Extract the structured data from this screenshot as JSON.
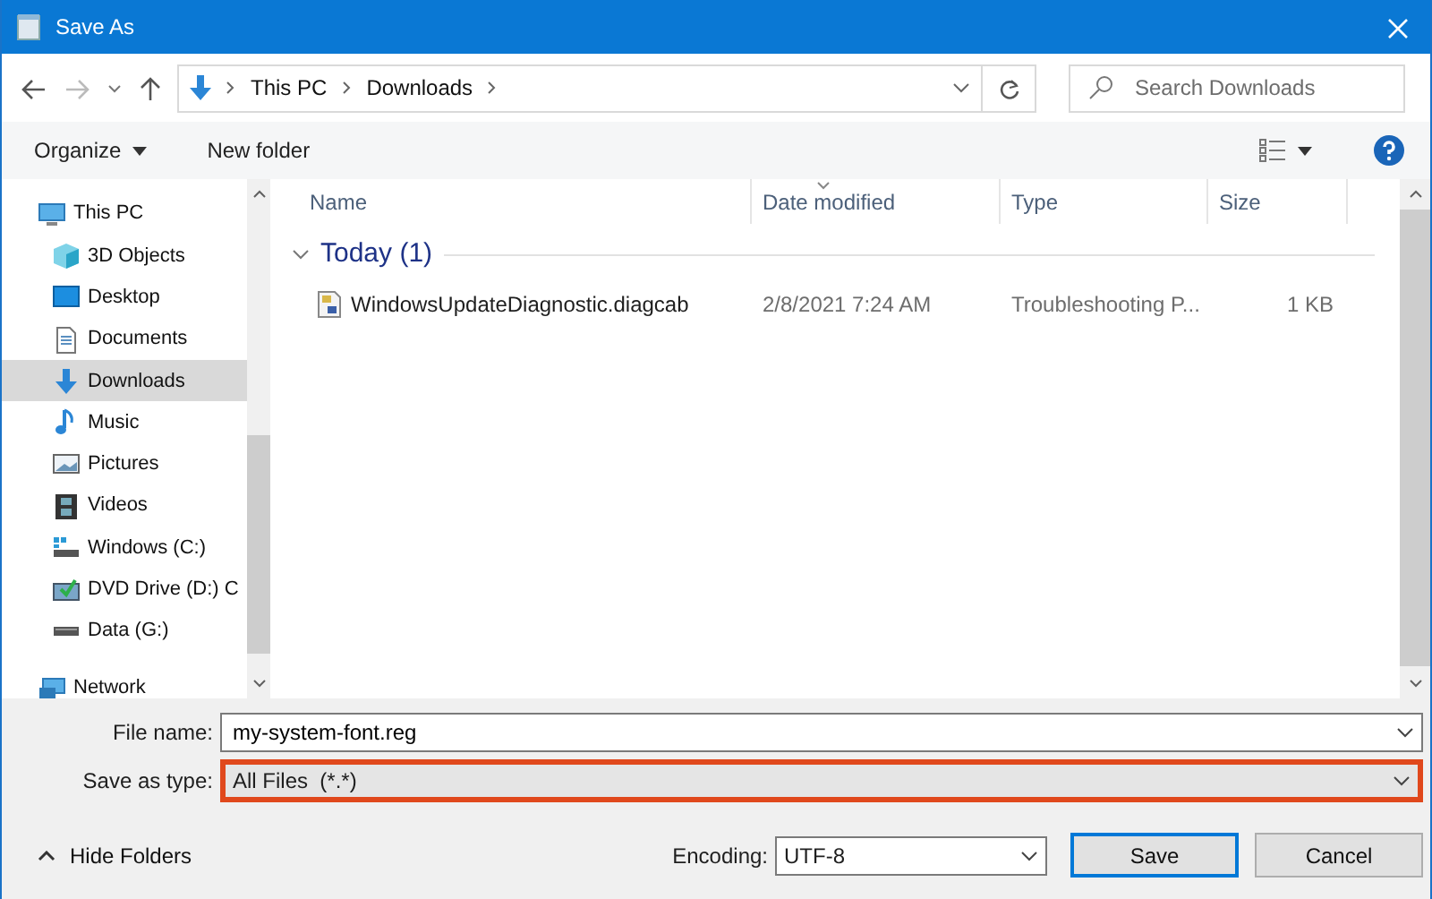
{
  "window": {
    "title": "Save As"
  },
  "navigation": {
    "breadcrumb": [
      "This PC",
      "Downloads"
    ]
  },
  "search": {
    "placeholder": "Search Downloads"
  },
  "toolbar": {
    "buttons": [
      "Organize",
      "New folder"
    ]
  },
  "sidebar": {
    "items": [
      {
        "label": "This PC",
        "kind": "computer",
        "selected": false,
        "children": [
          {
            "label": "3D Objects",
            "kind": "cube",
            "selected": false
          },
          {
            "label": "Desktop",
            "kind": "desktop",
            "selected": false
          },
          {
            "label": "Documents",
            "kind": "document",
            "selected": false
          },
          {
            "label": "Downloads",
            "kind": "download",
            "selected": true
          },
          {
            "label": "Music",
            "kind": "music",
            "selected": false
          },
          {
            "label": "Pictures",
            "kind": "pictures",
            "selected": false
          },
          {
            "label": "Videos",
            "kind": "video",
            "selected": false
          },
          {
            "label": "Windows (C:)",
            "kind": "system-drive",
            "selected": false
          },
          {
            "label": "DVD Drive (D:) C",
            "kind": "dvd",
            "selected": false
          },
          {
            "label": "Data (G:)",
            "kind": "drive",
            "selected": false
          }
        ]
      },
      {
        "label": "Network",
        "kind": "network",
        "selected": false
      }
    ]
  },
  "file_list": {
    "columns": [
      {
        "label": "Name",
        "sorted": false
      },
      {
        "label": "Date modified",
        "sorted": true
      },
      {
        "label": "Type",
        "sorted": false
      },
      {
        "label": "Size",
        "sorted": false
      }
    ],
    "groups": [
      {
        "label": "Today (1)",
        "expanded": true,
        "rows": [
          {
            "name": "WindowsUpdateDiagnostic.diagcab",
            "date_modified": "2/8/2021 7:24 AM",
            "type": "Troubleshooting P...",
            "size": "1 KB"
          }
        ]
      }
    ]
  },
  "form": {
    "file_name": {
      "label": "File name:",
      "value": "my-system-font.reg"
    },
    "save_as_type": {
      "label": "Save as type:",
      "value": "All Files  (*.*)",
      "highlighted": true
    }
  },
  "footer": {
    "hide_folders": "Hide Folders",
    "encoding": {
      "label": "Encoding:",
      "value": "UTF-8"
    },
    "buttons": [
      {
        "label": "Save",
        "default": true
      },
      {
        "label": "Cancel",
        "default": false
      }
    ]
  }
}
